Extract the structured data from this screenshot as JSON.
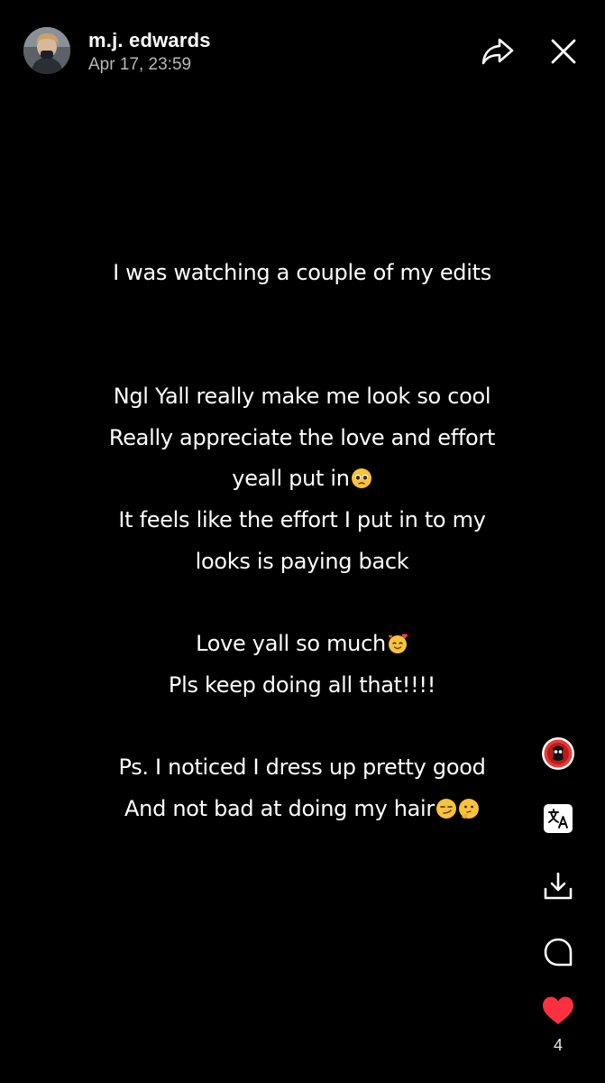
{
  "post": {
    "author": "m.j. edwards",
    "timestamp": "Apr 17, 23:59",
    "lines": [
      "I was watching a couple of my edits",
      "",
      "",
      "Ngl Yall really make me look so cool",
      "Really appreciate the love and effort",
      "yeall put in",
      "It feels like the effort I put in to my",
      "looks is paying back",
      "",
      "Love yall so much",
      "Pls keep doing all that!!!!",
      "",
      "Ps. I noticed I dress up pretty good",
      "And not bad at doing my hair"
    ],
    "emojis": {
      "line_5": [
        "pleading-face"
      ],
      "line_9": [
        "smiling-face-with-hearts"
      ],
      "line_13": [
        "smirking-face",
        "thinking-face"
      ]
    }
  },
  "actions": {
    "like_count": "4",
    "icons": [
      "sticker-icon",
      "translate-icon",
      "download-icon",
      "comment-icon",
      "heart-icon",
      "share-icon",
      "close-icon"
    ],
    "colors": {
      "background": "#000000",
      "like": "#ff3040",
      "sticker_ring": "#ff3b30"
    }
  }
}
